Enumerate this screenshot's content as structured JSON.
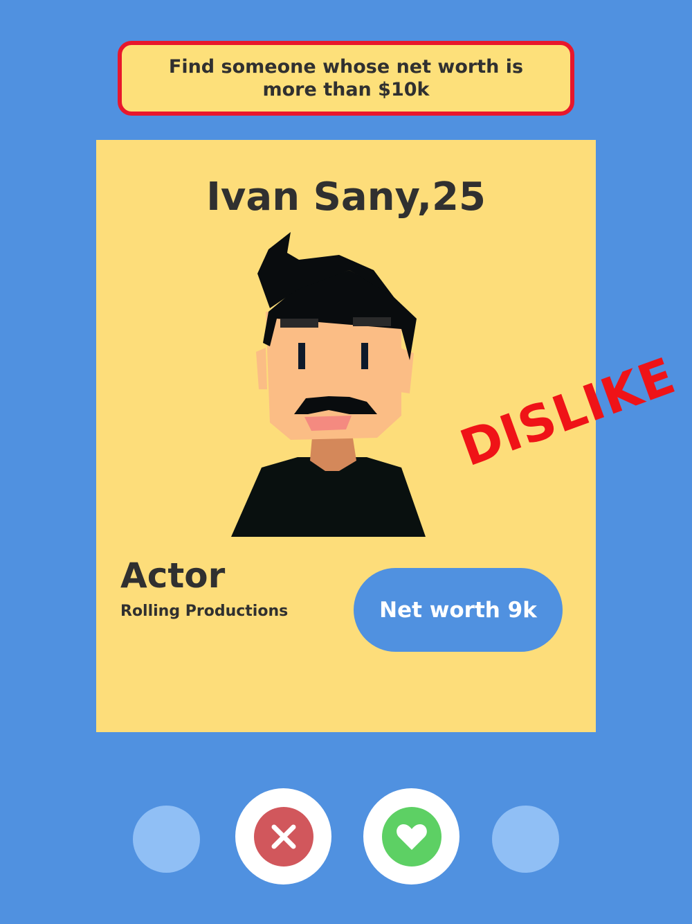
{
  "task": {
    "text": "Find someone whose net worth is more than $10k"
  },
  "profile": {
    "name_age": "Ivan Sany,25",
    "job": "Actor",
    "company": "Rolling Productions",
    "net_worth_label": "Net worth 9k"
  },
  "stamp": {
    "text": "DISLIKE"
  },
  "controls": {
    "left_button": "circle",
    "dislike_icon": "close-icon",
    "like_icon": "heart-icon",
    "right_button": "circle"
  },
  "colors": {
    "background": "#5091e0",
    "card": "#fddd7a",
    "banner_border": "#e8172c",
    "stamp": "#ef1317",
    "dislike": "#d1575c",
    "like": "#5dd064"
  }
}
